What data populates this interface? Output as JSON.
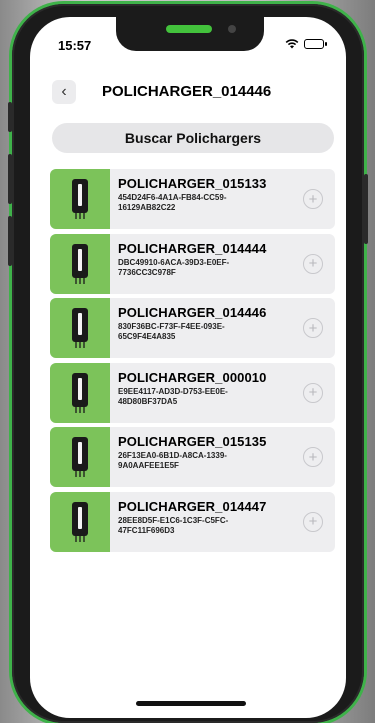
{
  "status_bar": {
    "time": "15:57"
  },
  "header": {
    "back_icon": "chevron-left-icon",
    "title": "POLICHARGER_014446"
  },
  "search": {
    "label": "Buscar Polichargers"
  },
  "colors": {
    "accent": "#7cc35a",
    "card_bg": "#eeeef0",
    "frame_green": "#3fb24a"
  },
  "devices": [
    {
      "name": "POLICHARGER_015133",
      "id": "454D24F6-4A1A-FB84-CC59-16129AB82C22"
    },
    {
      "name": "POLICHARGER_014444",
      "id": "DBC49910-6ACA-39D3-E0EF-7736CC3C978F"
    },
    {
      "name": "POLICHARGER_014446",
      "id": "830F36BC-F73F-F4EE-093E-65C9F4E4A835"
    },
    {
      "name": "POLICHARGER_000010",
      "id": "E9EE4117-AD3D-D753-EE0E-48D80BF37DA5"
    },
    {
      "name": "POLICHARGER_015135",
      "id": "26F13EA0-6B1D-A8CA-1339-9A0AAFEE1E5F"
    },
    {
      "name": "POLICHARGER_014447",
      "id": "28EE8D5F-E1C6-1C3F-C5FC-47FC11F696D3"
    }
  ]
}
